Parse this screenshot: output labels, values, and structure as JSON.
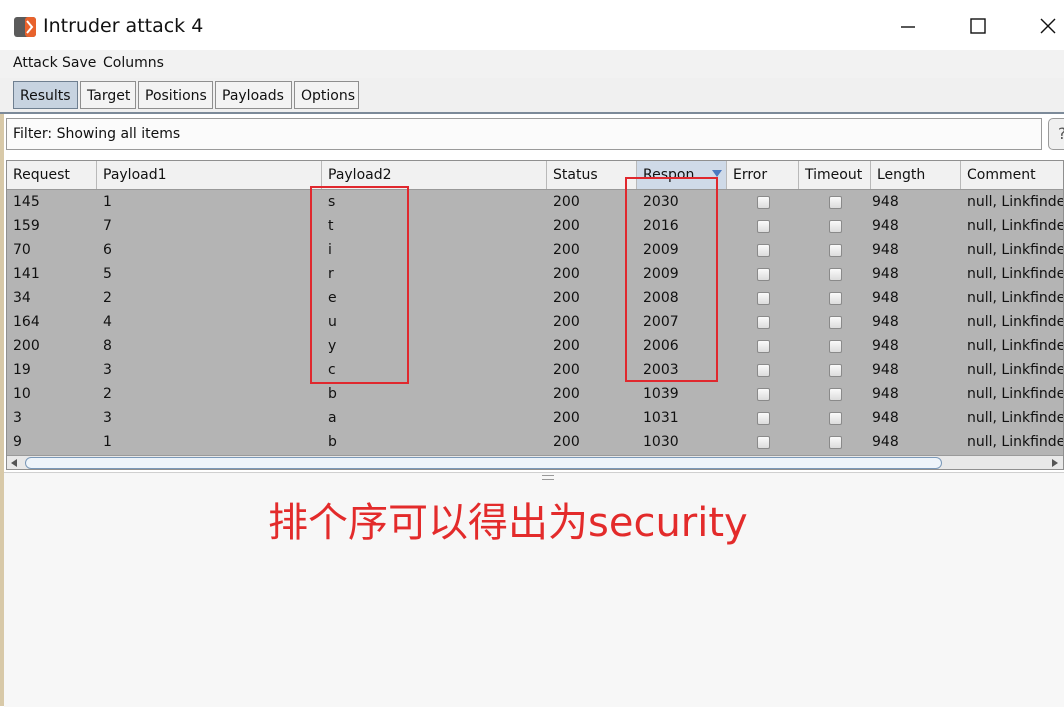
{
  "window": {
    "title": "Intruder attack 4"
  },
  "menu": [
    "Attack",
    "Save",
    "Columns"
  ],
  "tabs": [
    "Results",
    "Target",
    "Positions",
    "Payloads",
    "Options"
  ],
  "filter": {
    "text": "Filter: Showing all items"
  },
  "help": {
    "label": "?"
  },
  "table": {
    "columns": [
      "Request",
      "Payload1",
      "Payload2",
      "Status",
      "Respon...",
      "Error",
      "Timeout",
      "Length",
      "Comment"
    ],
    "sorted_column": "Respon...",
    "rows": [
      [
        "145",
        "1",
        "s",
        "200",
        "2030",
        "948",
        "null, Linkfinder"
      ],
      [
        "159",
        "7",
        "t",
        "200",
        "2016",
        "948",
        "null, Linkfinder"
      ],
      [
        "70",
        "6",
        "i",
        "200",
        "2009",
        "948",
        "null, Linkfinder"
      ],
      [
        "141",
        "5",
        "r",
        "200",
        "2009",
        "948",
        "null, Linkfinder"
      ],
      [
        "34",
        "2",
        "e",
        "200",
        "2008",
        "948",
        "null, Linkfinder"
      ],
      [
        "164",
        "4",
        "u",
        "200",
        "2007",
        "948",
        "null, Linkfinder"
      ],
      [
        "200",
        "8",
        "y",
        "200",
        "2006",
        "948",
        "null, Linkfinder"
      ],
      [
        "19",
        "3",
        "c",
        "200",
        "2003",
        "948",
        "null, Linkfinder"
      ],
      [
        "10",
        "2",
        "b",
        "200",
        "1039",
        "948",
        "null, Linkfinder"
      ],
      [
        "3",
        "3",
        "a",
        "200",
        "1031",
        "948",
        "null, Linkfinder"
      ],
      [
        "9",
        "1",
        "b",
        "200",
        "1030",
        "948",
        "null, Linkfinder"
      ]
    ]
  },
  "annotation": {
    "text": "排个序可以得出为security",
    "color": "#e32b2b"
  },
  "colors": {
    "highlight_box": "#e0282e",
    "table_bg": "#b4b4b4",
    "active_tab": "#c7d3e0"
  }
}
